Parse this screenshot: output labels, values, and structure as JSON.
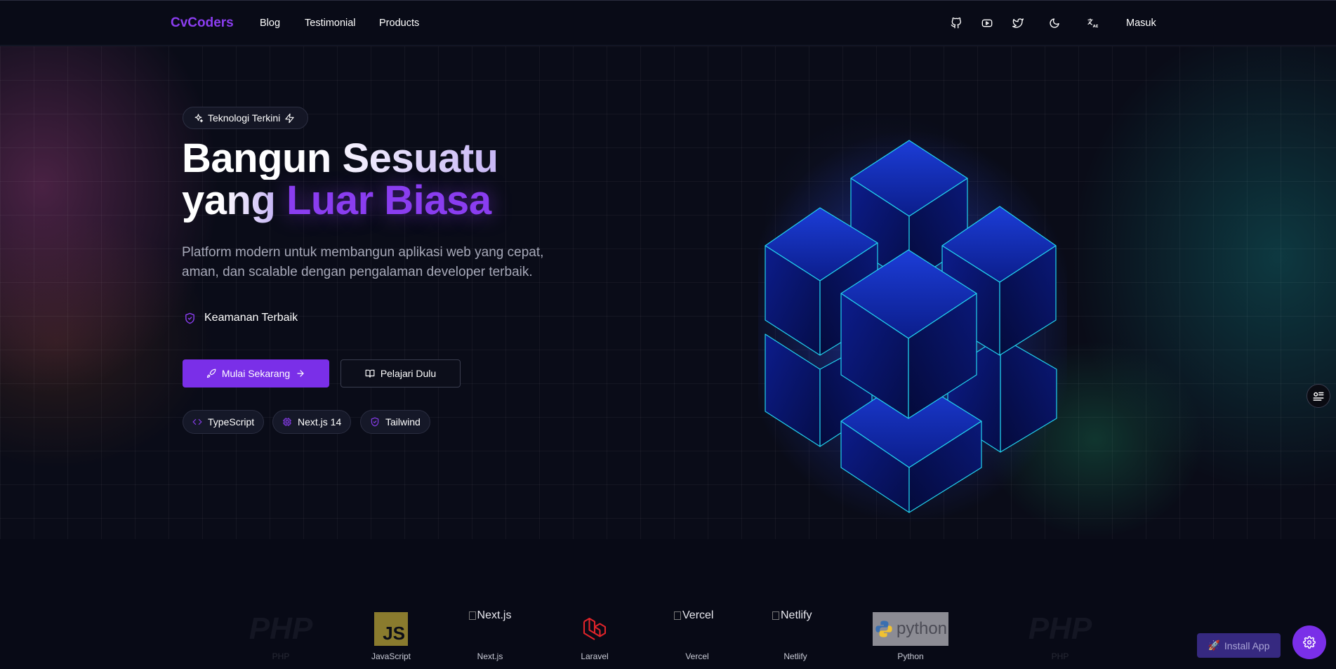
{
  "nav": {
    "brand": "CvCoders",
    "links": [
      "Blog",
      "Testimonial",
      "Products"
    ],
    "icons": [
      "github-icon",
      "youtube-icon",
      "twitter-icon",
      "moon-icon",
      "translate-icon"
    ],
    "login": "Masuk"
  },
  "hero": {
    "badge": "Teknologi Terkini",
    "title_line1": "Bangun Sesuatu",
    "title_line2_plain": "yang",
    "title_line2_accent": "Luar Biasa",
    "subtitle_line1": "Platform modern untuk membangun aplikasi web yang cepat,",
    "subtitle_line2": "aman, dan scalable dengan pengalaman developer terbaik.",
    "feature": "Keamanan Terbaik",
    "primary_button": "Mulai Sekarang",
    "secondary_button": "Pelajari Dulu",
    "chips": [
      "TypeScript",
      "Next.js 14",
      "Tailwind"
    ]
  },
  "logos": [
    {
      "name": "PHP",
      "caption": "PHP"
    },
    {
      "name": "JS",
      "caption": "JavaScript"
    },
    {
      "name": "Next.js",
      "caption": "Next.js"
    },
    {
      "name": "Laravel",
      "caption": "Laravel"
    },
    {
      "name": "Vercel",
      "caption": "Vercel"
    },
    {
      "name": "Netlify",
      "caption": "Netlify"
    },
    {
      "name": "python",
      "caption": "Python"
    },
    {
      "name": "PHP",
      "caption": "PHP"
    }
  ],
  "install_app": "Install App",
  "colors": {
    "accent": "#7a2fe8",
    "background": "#080a16",
    "cube_edge": "#22d3ee"
  }
}
